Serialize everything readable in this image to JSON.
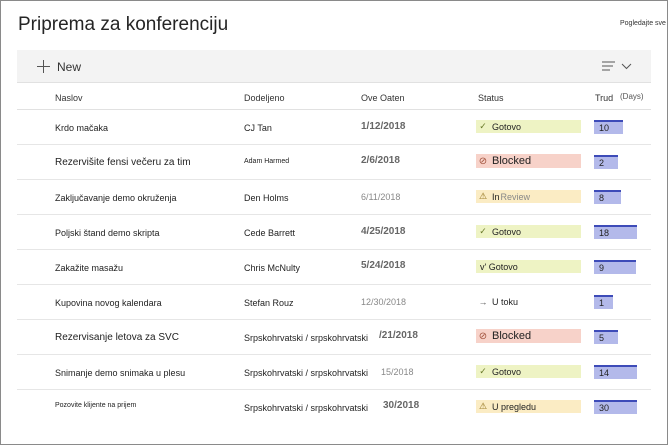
{
  "page": {
    "title": "Priprema za konferenciju",
    "see_all": "Pogledajte sve"
  },
  "toolbar": {
    "new_label": "New",
    "view_icon": "view-options-icon"
  },
  "columns": {
    "title": "Naslov",
    "assigned": "Dodeljeno",
    "due": "Ove Oaten",
    "status": "Status",
    "effort": "Trud",
    "effort_unit": "(Days)"
  },
  "colors": {
    "accent_bar": "#3d4bb8",
    "bar_fill": "#b3b9ea",
    "status_done": "#eef3c4",
    "status_blocked": "#f7d2c9",
    "status_review": "#fbecc4"
  },
  "rows": [
    {
      "title": "Krdo mačaka",
      "assignee": "CJ Tan",
      "due": "1/12/2018",
      "status": "Gotovo",
      "status_icon": "check-icon",
      "effort": "10",
      "effort_fraction": 0.33
    },
    {
      "title": "Rezervišite fensi večeru za tim",
      "assignee": "Adam Harmed",
      "due": "2/6/2018",
      "status": "Blocked",
      "status_icon": "blocked-icon",
      "effort": "2",
      "effort_fraction": 0.07
    },
    {
      "title": "Zaključavanje demo okruženja",
      "assignee": "Den Holms",
      "due": "6/11/2018",
      "status_a": "In",
      "status_b": "Review",
      "status_icon": "warning-icon",
      "effort": "8",
      "effort_fraction": 0.27
    },
    {
      "title": "Poljski štand demo skripta",
      "assignee": "Cede Barrett",
      "due": "4/25/2018",
      "status": "Gotovo",
      "status_icon": "check-icon",
      "effort": "18",
      "effort_fraction": 0.6
    },
    {
      "title": "Zakažite masažu",
      "assignee": "Chris McNulty",
      "due": "5/24/2018",
      "status": "v' Gotovo",
      "status_icon": "",
      "effort": "9",
      "effort_fraction": 0.3
    },
    {
      "title": "Kupovina novog kalendara",
      "assignee": "Stefan Rouz",
      "due": "12/30/2018",
      "status": "U toku",
      "status_icon": "arrow-right-icon",
      "effort": "1",
      "effort_fraction": 0.03
    },
    {
      "title": "Rezervisanje letova za SVC",
      "assignee": "Srpskohrvatski / srpskohrvatski",
      "due_tail": "/21/2018",
      "status": "Blocked",
      "status_icon": "blocked-icon",
      "effort": "5",
      "effort_fraction": 0.17
    },
    {
      "title": "Snimanje demo snimaka u plesu",
      "assignee": "Srpskohrvatski / srpskohrvatski",
      "due_tail": "15/2018",
      "status": "Gotovo",
      "status_icon": "check-icon",
      "effort": "14",
      "effort_fraction": 0.47
    },
    {
      "title": "Pozovite klijente na prijem",
      "assignee": "Srpskohrvatski / srpskohrvatski",
      "due_tail": "30/2018",
      "status": "U pregledu",
      "status_icon": "warning-icon",
      "effort": "30",
      "effort_fraction": 1.0
    }
  ]
}
